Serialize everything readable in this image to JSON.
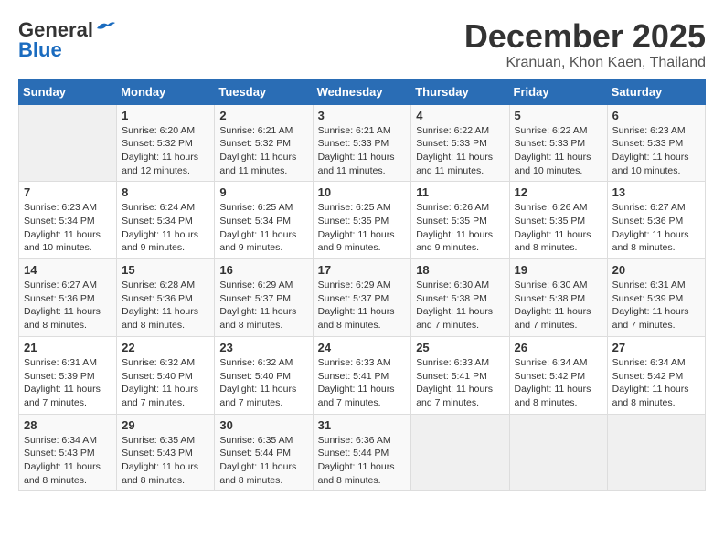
{
  "logo": {
    "general": "General",
    "blue": "Blue"
  },
  "title": "December 2025",
  "location": "Kranuan, Khon Kaen, Thailand",
  "days_header": [
    "Sunday",
    "Monday",
    "Tuesday",
    "Wednesday",
    "Thursday",
    "Friday",
    "Saturday"
  ],
  "weeks": [
    [
      {
        "num": "",
        "sunrise": "",
        "sunset": "",
        "daylight": ""
      },
      {
        "num": "1",
        "sunrise": "Sunrise: 6:20 AM",
        "sunset": "Sunset: 5:32 PM",
        "daylight": "Daylight: 11 hours and 12 minutes."
      },
      {
        "num": "2",
        "sunrise": "Sunrise: 6:21 AM",
        "sunset": "Sunset: 5:32 PM",
        "daylight": "Daylight: 11 hours and 11 minutes."
      },
      {
        "num": "3",
        "sunrise": "Sunrise: 6:21 AM",
        "sunset": "Sunset: 5:33 PM",
        "daylight": "Daylight: 11 hours and 11 minutes."
      },
      {
        "num": "4",
        "sunrise": "Sunrise: 6:22 AM",
        "sunset": "Sunset: 5:33 PM",
        "daylight": "Daylight: 11 hours and 11 minutes."
      },
      {
        "num": "5",
        "sunrise": "Sunrise: 6:22 AM",
        "sunset": "Sunset: 5:33 PM",
        "daylight": "Daylight: 11 hours and 10 minutes."
      },
      {
        "num": "6",
        "sunrise": "Sunrise: 6:23 AM",
        "sunset": "Sunset: 5:33 PM",
        "daylight": "Daylight: 11 hours and 10 minutes."
      }
    ],
    [
      {
        "num": "7",
        "sunrise": "Sunrise: 6:23 AM",
        "sunset": "Sunset: 5:34 PM",
        "daylight": "Daylight: 11 hours and 10 minutes."
      },
      {
        "num": "8",
        "sunrise": "Sunrise: 6:24 AM",
        "sunset": "Sunset: 5:34 PM",
        "daylight": "Daylight: 11 hours and 9 minutes."
      },
      {
        "num": "9",
        "sunrise": "Sunrise: 6:25 AM",
        "sunset": "Sunset: 5:34 PM",
        "daylight": "Daylight: 11 hours and 9 minutes."
      },
      {
        "num": "10",
        "sunrise": "Sunrise: 6:25 AM",
        "sunset": "Sunset: 5:35 PM",
        "daylight": "Daylight: 11 hours and 9 minutes."
      },
      {
        "num": "11",
        "sunrise": "Sunrise: 6:26 AM",
        "sunset": "Sunset: 5:35 PM",
        "daylight": "Daylight: 11 hours and 9 minutes."
      },
      {
        "num": "12",
        "sunrise": "Sunrise: 6:26 AM",
        "sunset": "Sunset: 5:35 PM",
        "daylight": "Daylight: 11 hours and 8 minutes."
      },
      {
        "num": "13",
        "sunrise": "Sunrise: 6:27 AM",
        "sunset": "Sunset: 5:36 PM",
        "daylight": "Daylight: 11 hours and 8 minutes."
      }
    ],
    [
      {
        "num": "14",
        "sunrise": "Sunrise: 6:27 AM",
        "sunset": "Sunset: 5:36 PM",
        "daylight": "Daylight: 11 hours and 8 minutes."
      },
      {
        "num": "15",
        "sunrise": "Sunrise: 6:28 AM",
        "sunset": "Sunset: 5:36 PM",
        "daylight": "Daylight: 11 hours and 8 minutes."
      },
      {
        "num": "16",
        "sunrise": "Sunrise: 6:29 AM",
        "sunset": "Sunset: 5:37 PM",
        "daylight": "Daylight: 11 hours and 8 minutes."
      },
      {
        "num": "17",
        "sunrise": "Sunrise: 6:29 AM",
        "sunset": "Sunset: 5:37 PM",
        "daylight": "Daylight: 11 hours and 8 minutes."
      },
      {
        "num": "18",
        "sunrise": "Sunrise: 6:30 AM",
        "sunset": "Sunset: 5:38 PM",
        "daylight": "Daylight: 11 hours and 7 minutes."
      },
      {
        "num": "19",
        "sunrise": "Sunrise: 6:30 AM",
        "sunset": "Sunset: 5:38 PM",
        "daylight": "Daylight: 11 hours and 7 minutes."
      },
      {
        "num": "20",
        "sunrise": "Sunrise: 6:31 AM",
        "sunset": "Sunset: 5:39 PM",
        "daylight": "Daylight: 11 hours and 7 minutes."
      }
    ],
    [
      {
        "num": "21",
        "sunrise": "Sunrise: 6:31 AM",
        "sunset": "Sunset: 5:39 PM",
        "daylight": "Daylight: 11 hours and 7 minutes."
      },
      {
        "num": "22",
        "sunrise": "Sunrise: 6:32 AM",
        "sunset": "Sunset: 5:40 PM",
        "daylight": "Daylight: 11 hours and 7 minutes."
      },
      {
        "num": "23",
        "sunrise": "Sunrise: 6:32 AM",
        "sunset": "Sunset: 5:40 PM",
        "daylight": "Daylight: 11 hours and 7 minutes."
      },
      {
        "num": "24",
        "sunrise": "Sunrise: 6:33 AM",
        "sunset": "Sunset: 5:41 PM",
        "daylight": "Daylight: 11 hours and 7 minutes."
      },
      {
        "num": "25",
        "sunrise": "Sunrise: 6:33 AM",
        "sunset": "Sunset: 5:41 PM",
        "daylight": "Daylight: 11 hours and 7 minutes."
      },
      {
        "num": "26",
        "sunrise": "Sunrise: 6:34 AM",
        "sunset": "Sunset: 5:42 PM",
        "daylight": "Daylight: 11 hours and 8 minutes."
      },
      {
        "num": "27",
        "sunrise": "Sunrise: 6:34 AM",
        "sunset": "Sunset: 5:42 PM",
        "daylight": "Daylight: 11 hours and 8 minutes."
      }
    ],
    [
      {
        "num": "28",
        "sunrise": "Sunrise: 6:34 AM",
        "sunset": "Sunset: 5:43 PM",
        "daylight": "Daylight: 11 hours and 8 minutes."
      },
      {
        "num": "29",
        "sunrise": "Sunrise: 6:35 AM",
        "sunset": "Sunset: 5:43 PM",
        "daylight": "Daylight: 11 hours and 8 minutes."
      },
      {
        "num": "30",
        "sunrise": "Sunrise: 6:35 AM",
        "sunset": "Sunset: 5:44 PM",
        "daylight": "Daylight: 11 hours and 8 minutes."
      },
      {
        "num": "31",
        "sunrise": "Sunrise: 6:36 AM",
        "sunset": "Sunset: 5:44 PM",
        "daylight": "Daylight: 11 hours and 8 minutes."
      },
      {
        "num": "",
        "sunrise": "",
        "sunset": "",
        "daylight": ""
      },
      {
        "num": "",
        "sunrise": "",
        "sunset": "",
        "daylight": ""
      },
      {
        "num": "",
        "sunrise": "",
        "sunset": "",
        "daylight": ""
      }
    ]
  ]
}
